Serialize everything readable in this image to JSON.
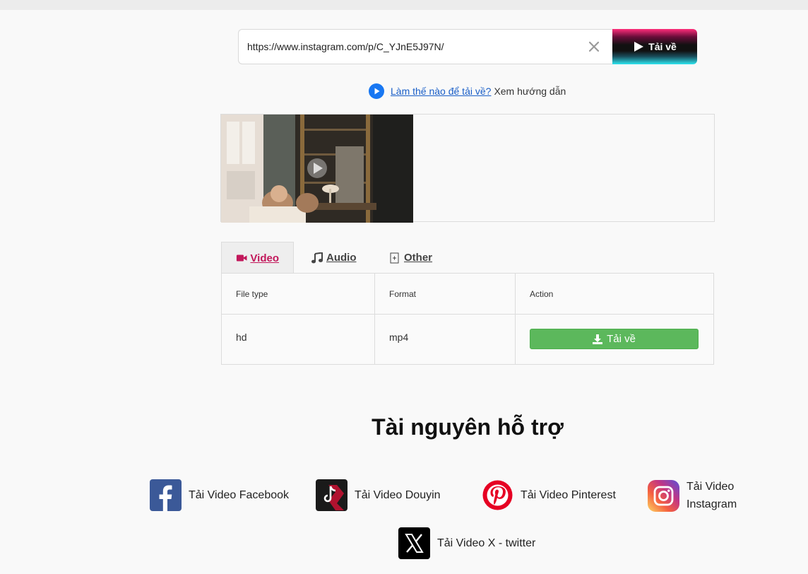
{
  "search": {
    "value": "https://www.instagram.com/p/C_YJnE5J97N/",
    "download_label": "Tải về"
  },
  "howto": {
    "link_text": "Làm thế nào để tải về?",
    "tail_text": "Xem hướng dẫn"
  },
  "tabs": [
    {
      "label": "Video",
      "icon": "video-camera-icon",
      "active": true
    },
    {
      "label": "Audio",
      "icon": "music-note-icon",
      "active": false
    },
    {
      "label": "Other",
      "icon": "file-plus-icon",
      "active": false
    }
  ],
  "table": {
    "headers": [
      "File type",
      "Format",
      "Action"
    ],
    "rows": [
      {
        "file_type": "hd",
        "format": "mp4",
        "action_label": "Tải về"
      }
    ]
  },
  "resources": {
    "title": "Tài nguyên hỗ trợ",
    "items": [
      {
        "label": "Tải Video Facebook",
        "icon": "facebook-icon"
      },
      {
        "label": "Tải Video Douyin",
        "icon": "douyin-icon"
      },
      {
        "label": "Tải Video Pinterest",
        "icon": "pinterest-icon"
      },
      {
        "label": "Tải Video Instagram",
        "icon": "instagram-icon"
      },
      {
        "label": "Tải Video X - twitter",
        "icon": "x-twitter-icon"
      }
    ]
  },
  "colors": {
    "accent_tab": "#c2185b",
    "download_green": "#5cb85c",
    "link_blue": "#1a5fc8"
  }
}
